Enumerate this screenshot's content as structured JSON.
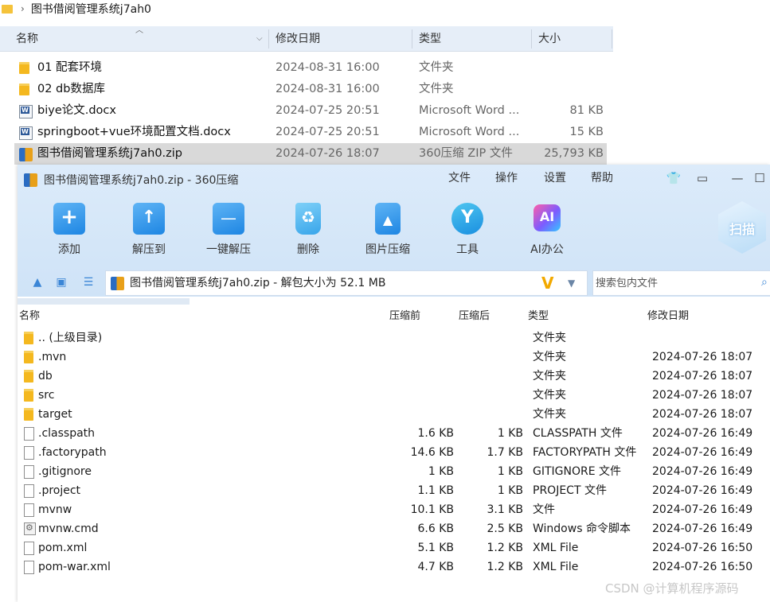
{
  "explorer": {
    "breadcrumb": "图书借阅管理系统j7ah0",
    "columns": {
      "name": "名称",
      "modified": "修改日期",
      "type": "类型",
      "size": "大小"
    },
    "rows": [
      {
        "name": "01 配套环境",
        "modified": "2024-08-31 16:00",
        "type": "文件夹",
        "size": "",
        "icon": "folder-icon"
      },
      {
        "name": "02 db数据库",
        "modified": "2024-08-31 16:00",
        "type": "文件夹",
        "size": "",
        "icon": "folder-icon"
      },
      {
        "name": "biye论文.docx",
        "modified": "2024-07-25 20:51",
        "type": "Microsoft Word ...",
        "size": "81 KB",
        "icon": "word-doc-icon"
      },
      {
        "name": "springboot+vue环境配置文档.docx",
        "modified": "2024-07-25 20:51",
        "type": "Microsoft Word ...",
        "size": "15 KB",
        "icon": "word-doc-icon"
      },
      {
        "name": "图书借阅管理系统j7ah0.zip",
        "modified": "2024-07-26 18:07",
        "type": "360压缩 ZIP 文件",
        "size": "25,793 KB",
        "icon": "zip-archive-icon",
        "selected": true
      }
    ]
  },
  "zip": {
    "title": "图书借阅管理系统j7ah0.zip - 360压缩",
    "menu": [
      "文件",
      "操作",
      "设置",
      "帮助"
    ],
    "window_buttons": [
      "👕",
      "▭",
      "—",
      "☐"
    ],
    "toolbar": [
      {
        "label": "添加",
        "icon": "add-icon"
      },
      {
        "label": "解压到",
        "icon": "extract-to-icon"
      },
      {
        "label": "一键解压",
        "icon": "one-click-extract-icon"
      },
      {
        "label": "删除",
        "icon": "delete-icon"
      },
      {
        "label": "图片压缩",
        "icon": "image-compress-icon"
      },
      {
        "label": "工具",
        "icon": "tools-icon"
      },
      {
        "label": "AI办公",
        "icon": "ai-office-icon"
      }
    ],
    "scan_label": "扫描",
    "address": "图书借阅管理系统j7ah0.zip - 解包大小为 52.1 MB",
    "search_placeholder": "搜索包内文件",
    "columns": {
      "name": "名称",
      "packed": "压缩前",
      "compressed": "压缩后",
      "type": "类型",
      "modified": "修改日期"
    },
    "rows": [
      {
        "name": ".. (上级目录)",
        "packed": "",
        "compressed": "",
        "type": "文件夹",
        "modified": "",
        "icon": "folder"
      },
      {
        "name": ".mvn",
        "packed": "",
        "compressed": "",
        "type": "文件夹",
        "modified": "2024-07-26 18:07",
        "icon": "folder"
      },
      {
        "name": "db",
        "packed": "",
        "compressed": "",
        "type": "文件夹",
        "modified": "2024-07-26 18:07",
        "icon": "folder"
      },
      {
        "name": "src",
        "packed": "",
        "compressed": "",
        "type": "文件夹",
        "modified": "2024-07-26 18:07",
        "icon": "folder"
      },
      {
        "name": "target",
        "packed": "",
        "compressed": "",
        "type": "文件夹",
        "modified": "2024-07-26 18:07",
        "icon": "folder"
      },
      {
        "name": ".classpath",
        "packed": "1.6 KB",
        "compressed": "1 KB",
        "type": "CLASSPATH 文件",
        "modified": "2024-07-26 16:49",
        "icon": "file"
      },
      {
        "name": ".factorypath",
        "packed": "14.6 KB",
        "compressed": "1.7 KB",
        "type": "FACTORYPATH 文件",
        "modified": "2024-07-26 16:49",
        "icon": "file"
      },
      {
        "name": ".gitignore",
        "packed": "1 KB",
        "compressed": "1 KB",
        "type": "GITIGNORE 文件",
        "modified": "2024-07-26 16:49",
        "icon": "file"
      },
      {
        "name": ".project",
        "packed": "1.1 KB",
        "compressed": "1 KB",
        "type": "PROJECT 文件",
        "modified": "2024-07-26 16:49",
        "icon": "file"
      },
      {
        "name": "mvnw",
        "packed": "10.1 KB",
        "compressed": "3.1 KB",
        "type": "文件",
        "modified": "2024-07-26 16:49",
        "icon": "file"
      },
      {
        "name": "mvnw.cmd",
        "packed": "6.6 KB",
        "compressed": "2.5 KB",
        "type": "Windows 命令脚本",
        "modified": "2024-07-26 16:49",
        "icon": "cmd"
      },
      {
        "name": "pom.xml",
        "packed": "5.1 KB",
        "compressed": "1.2 KB",
        "type": "XML File",
        "modified": "2024-07-26 16:50",
        "icon": "file"
      },
      {
        "name": "pom-war.xml",
        "packed": "4.7 KB",
        "compressed": "1.2 KB",
        "type": "XML File",
        "modified": "2024-07-26 16:50",
        "icon": "file"
      }
    ]
  },
  "watermark": "CSDN @计算机程序源码"
}
